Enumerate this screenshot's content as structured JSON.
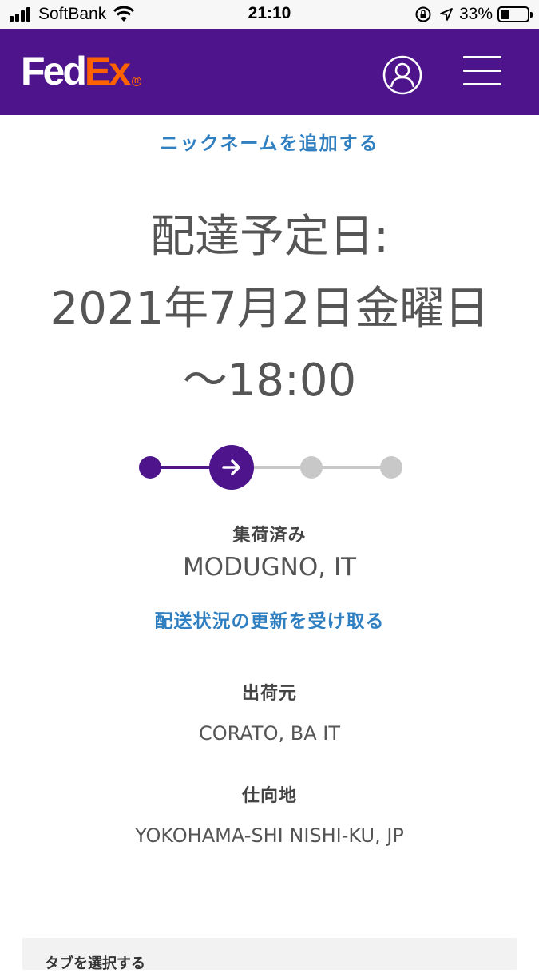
{
  "status_bar": {
    "carrier": "SoftBank",
    "time": "21:10",
    "battery_percent": "33%",
    "battery_level": 0.33,
    "icons": [
      "signal-icon",
      "wifi-icon",
      "orientation-lock-icon",
      "location-icon",
      "battery-icon"
    ]
  },
  "header": {
    "logo_fed": "Fed",
    "logo_ex": "Ex",
    "logo_reg": "R",
    "background_color": "#4d148c",
    "accent_color": "#ff6200",
    "icons": [
      "account-icon",
      "menu-icon"
    ]
  },
  "shipment": {
    "nickname_link": "ニックネームを追加する",
    "delivery_label": "配達予定日:",
    "delivery_date": "2021年7月2日金曜日",
    "delivery_time": "〜18:00",
    "progress": {
      "total_steps": 4,
      "current_step": 2
    },
    "status": "集荷済み",
    "status_location": "MODUGNO, IT",
    "updates_link": "配送状況の更新を受け取る",
    "origin_label": "出荷元",
    "origin": "CORATO, BA IT",
    "destination_label": "仕向地",
    "destination": "YOKOHAMA-SHI NISHI-KU, JP"
  },
  "tabs": {
    "select_label": "タブを選択する"
  },
  "colors": {
    "link": "#2f7fc1",
    "progress_active": "#4d148c",
    "progress_inactive": "#c8c8c8"
  }
}
